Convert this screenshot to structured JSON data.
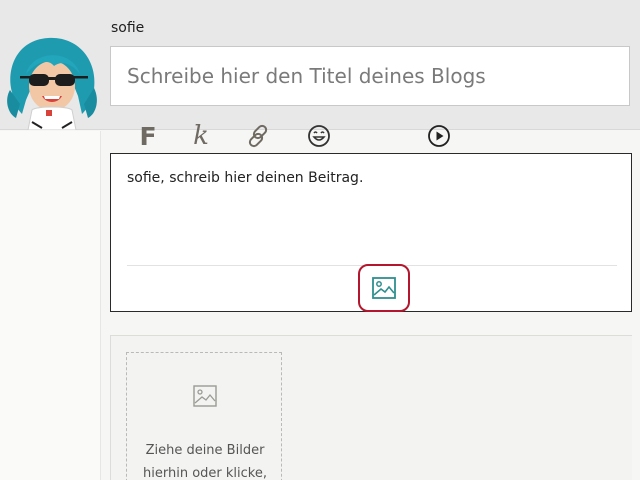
{
  "user": {
    "name": "sofie",
    "avatar_icon": "cartoon-avatar-teal-hair-sunglasses"
  },
  "title_field": {
    "placeholder": "Schreibe hier den Titel deines Blogs"
  },
  "post_editor": {
    "placeholder": "sofie, schreib hier deinen Beitrag.",
    "border_color": "#2a2a2a"
  },
  "toolbar": {
    "bold_label": "F",
    "italic_label": "k",
    "buttons": [
      {
        "name": "bold",
        "icon": "bold-icon"
      },
      {
        "name": "italic",
        "icon": "italic-icon"
      },
      {
        "name": "link",
        "icon": "link-icon"
      },
      {
        "name": "emoji",
        "icon": "emoji-icon"
      },
      {
        "name": "image",
        "icon": "image-icon",
        "highlighted": true
      },
      {
        "name": "video",
        "icon": "play-icon"
      }
    ],
    "icon_color": "#6f6a62",
    "highlight_color": "#b3162d",
    "image_icon_color": "#2f8f8f"
  },
  "image_upload": {
    "dropzone_text": "Ziehe deine Bilder hierhin oder klicke,",
    "icon": "image-placeholder-icon"
  }
}
